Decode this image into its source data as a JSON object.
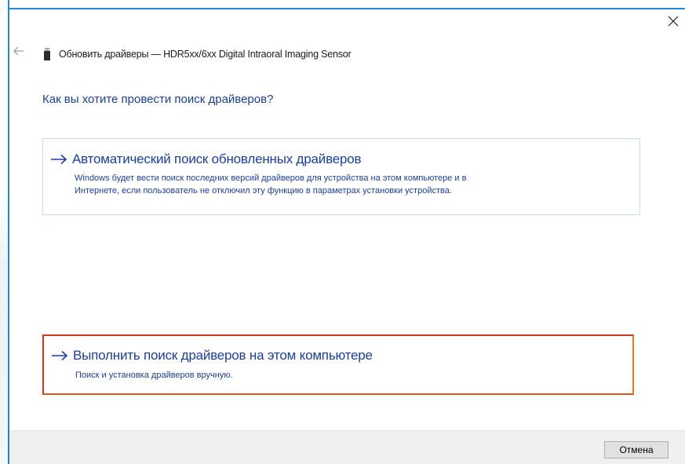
{
  "window": {
    "title": "Обновить драйверы — HDR5xx/6xx Digital Intraoral Imaging Sensor",
    "accent_color": "#1e88d6"
  },
  "icons": {
    "close": "close-icon",
    "back": "back-arrow-icon",
    "device": "usb-device-icon",
    "option_arrow": "right-arrow-icon"
  },
  "main": {
    "question": "Как вы хотите провести поиск драйверов?",
    "options": [
      {
        "title": "Автоматический поиск обновленных драйверов",
        "description_line1": "Windows будет вести поиск последних версий драйверов для устройства на этом компьютере и в",
        "description_line2": "Интернете, если пользователь не отключил эту функцию в параметрах установки устройства.",
        "highlighted": false
      },
      {
        "title": "Выполнить поиск драйверов на этом компьютере",
        "description_line1": "Поиск и установка драйверов вручную.",
        "highlighted": true,
        "highlight_color": "#d0361a"
      }
    ],
    "link_color": "#1a3fa0"
  },
  "footer": {
    "cancel_label": "Отмена"
  }
}
